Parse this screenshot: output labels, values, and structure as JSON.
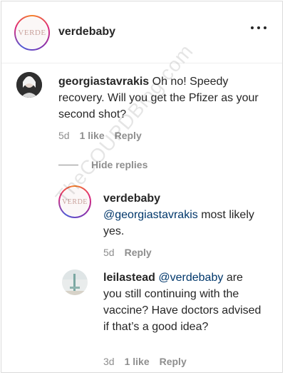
{
  "post": {
    "username": "verdebaby",
    "avatar_logo_text": "VERDE"
  },
  "comments": [
    {
      "username": "georgiastavrakis",
      "text": "Oh no! Speedy recovery. Will you get the Pfizer as your second shot?",
      "time": "5d",
      "likes": "1 like",
      "reply_label": "Reply"
    }
  ],
  "hide_replies_label": "Hide replies",
  "replies": [
    {
      "username": "verdebaby",
      "mention": "@georgiastavrakis",
      "text": "most likely yes.",
      "time": "5d",
      "reply_label": "Reply",
      "avatar_logo_text": "VERDE"
    },
    {
      "username": "leilastead",
      "mention": "@verdebaby",
      "text_before": "are you still continuing with the vaccine? Have doctors advised if that’s a good idea?",
      "time": "3d",
      "likes": "1 like",
      "reply_label": "Reply"
    }
  ],
  "watermark": "TheCOUPDBlog.com"
}
